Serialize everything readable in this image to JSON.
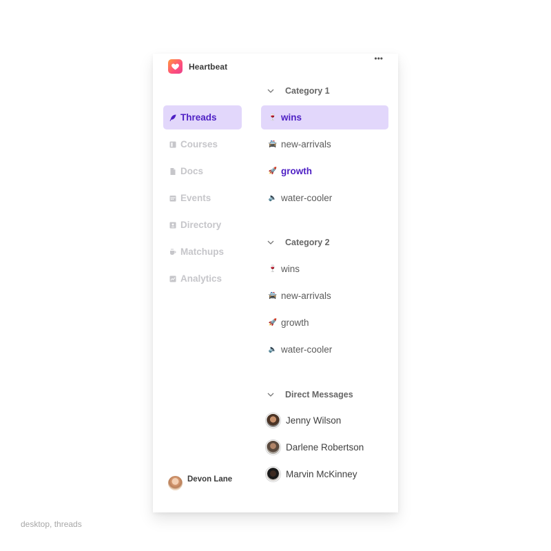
{
  "app": {
    "name": "Heartbeat"
  },
  "nav": {
    "items": [
      {
        "label": "Threads",
        "icon": "feather-icon",
        "active": true
      },
      {
        "label": "Courses",
        "icon": "book-icon",
        "active": false
      },
      {
        "label": "Docs",
        "icon": "document-icon",
        "active": false
      },
      {
        "label": "Events",
        "icon": "calendar-icon",
        "active": false
      },
      {
        "label": "Directory",
        "icon": "contact-card-icon",
        "active": false
      },
      {
        "label": "Matchups",
        "icon": "coffee-cup-icon",
        "active": false
      },
      {
        "label": "Analytics",
        "icon": "chart-icon",
        "active": false
      }
    ]
  },
  "user": {
    "name": "Devon Lane"
  },
  "categories": [
    {
      "title": "Category 1",
      "channels": [
        {
          "label": "wins",
          "emoji": "🍷",
          "state": "active"
        },
        {
          "label": "new-arrivals",
          "emoji": "🚔",
          "state": "normal"
        },
        {
          "label": "growth",
          "emoji": "🚀",
          "state": "unread"
        },
        {
          "label": "water-cooler",
          "emoji": "🔈",
          "state": "normal"
        }
      ]
    },
    {
      "title": "Category 2",
      "channels": [
        {
          "label": "wins",
          "emoji": "🍷",
          "state": "normal"
        },
        {
          "label": "new-arrivals",
          "emoji": "🚔",
          "state": "normal"
        },
        {
          "label": "growth",
          "emoji": "🚀",
          "state": "normal"
        },
        {
          "label": "water-cooler",
          "emoji": "🔈",
          "state": "normal"
        }
      ]
    }
  ],
  "direct_messages": {
    "title": "Direct Messages",
    "people": [
      {
        "name": "Jenny Wilson"
      },
      {
        "name": "Darlene Robertson"
      },
      {
        "name": "Marvin McKinney"
      }
    ]
  },
  "colors": {
    "accent": "#4d1fc4",
    "active_bg": "#e2d7fb",
    "muted_nav": "#c6c6ca"
  },
  "caption": "desktop, threads"
}
